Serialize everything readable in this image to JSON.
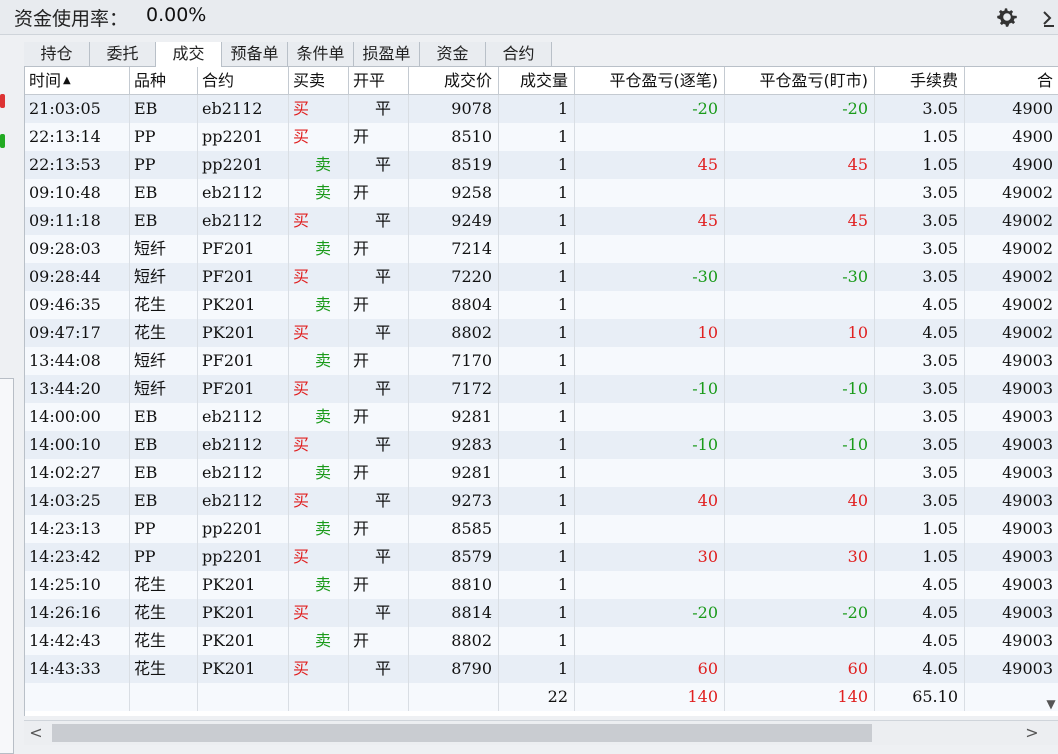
{
  "header": {
    "usage_label": "资金使用率：",
    "usage_value": "0.00%",
    "settings_icon": "gear-icon",
    "corner_icon": "chevron-icon"
  },
  "tabs": [
    {
      "label": "持仓"
    },
    {
      "label": "委托"
    },
    {
      "label": "成交",
      "active": true
    },
    {
      "label": "预备单"
    },
    {
      "label": "条件单"
    },
    {
      "label": "损盈单"
    },
    {
      "label": "资金"
    },
    {
      "label": "合约"
    }
  ],
  "table": {
    "columns": [
      "时间",
      "品种",
      "合约",
      "买卖",
      "开平",
      "成交价",
      "成交量",
      "平仓盈亏(逐笔)",
      "平仓盈亏(盯市)",
      "手续费",
      "合"
    ],
    "rows": [
      [
        "21:03:05",
        "EB",
        "eb2112",
        "买",
        "平",
        "9078",
        "1",
        "-20",
        "-20",
        "3.05",
        "4900"
      ],
      [
        "22:13:14",
        "PP",
        "pp2201",
        "买",
        "开",
        "8510",
        "1",
        "",
        "",
        "1.05",
        "4900"
      ],
      [
        "22:13:53",
        "PP",
        "pp2201",
        "卖",
        "平",
        "8519",
        "1",
        "45",
        "45",
        "1.05",
        "4900"
      ],
      [
        "09:10:48",
        "EB",
        "eb2112",
        "卖",
        "开",
        "9258",
        "1",
        "",
        "",
        "3.05",
        "49002"
      ],
      [
        "09:11:18",
        "EB",
        "eb2112",
        "买",
        "平",
        "9249",
        "1",
        "45",
        "45",
        "3.05",
        "49002"
      ],
      [
        "09:28:03",
        "短纤",
        "PF201",
        "卖",
        "开",
        "7214",
        "1",
        "",
        "",
        "3.05",
        "49002"
      ],
      [
        "09:28:44",
        "短纤",
        "PF201",
        "买",
        "平",
        "7220",
        "1",
        "-30",
        "-30",
        "3.05",
        "49002"
      ],
      [
        "09:46:35",
        "花生",
        "PK201",
        "卖",
        "开",
        "8804",
        "1",
        "",
        "",
        "4.05",
        "49002"
      ],
      [
        "09:47:17",
        "花生",
        "PK201",
        "买",
        "平",
        "8802",
        "1",
        "10",
        "10",
        "4.05",
        "49002"
      ],
      [
        "13:44:08",
        "短纤",
        "PF201",
        "卖",
        "开",
        "7170",
        "1",
        "",
        "",
        "3.05",
        "49003"
      ],
      [
        "13:44:20",
        "短纤",
        "PF201",
        "买",
        "平",
        "7172",
        "1",
        "-10",
        "-10",
        "3.05",
        "49003"
      ],
      [
        "14:00:00",
        "EB",
        "eb2112",
        "卖",
        "开",
        "9281",
        "1",
        "",
        "",
        "3.05",
        "49003"
      ],
      [
        "14:00:10",
        "EB",
        "eb2112",
        "买",
        "平",
        "9283",
        "1",
        "-10",
        "-10",
        "3.05",
        "49003"
      ],
      [
        "14:02:27",
        "EB",
        "eb2112",
        "卖",
        "开",
        "9281",
        "1",
        "",
        "",
        "3.05",
        "49003"
      ],
      [
        "14:03:25",
        "EB",
        "eb2112",
        "买",
        "平",
        "9273",
        "1",
        "40",
        "40",
        "3.05",
        "49003"
      ],
      [
        "14:23:13",
        "PP",
        "pp2201",
        "卖",
        "开",
        "8585",
        "1",
        "",
        "",
        "1.05",
        "49003"
      ],
      [
        "14:23:42",
        "PP",
        "pp2201",
        "买",
        "平",
        "8579",
        "1",
        "30",
        "30",
        "1.05",
        "49003"
      ],
      [
        "14:25:10",
        "花生",
        "PK201",
        "卖",
        "开",
        "8810",
        "1",
        "",
        "",
        "4.05",
        "49003"
      ],
      [
        "14:26:16",
        "花生",
        "PK201",
        "买",
        "平",
        "8814",
        "1",
        "-20",
        "-20",
        "4.05",
        "49003"
      ],
      [
        "14:42:43",
        "花生",
        "PK201",
        "卖",
        "开",
        "8802",
        "1",
        "",
        "",
        "4.05",
        "49003"
      ],
      [
        "14:43:33",
        "花生",
        "PK201",
        "买",
        "平",
        "8790",
        "1",
        "60",
        "60",
        "4.05",
        "49003"
      ]
    ],
    "totals": {
      "volume": "22",
      "pnl_trade": "140",
      "pnl_mark": "140",
      "fee": "65.10"
    },
    "colors": {
      "buy": "#e02020",
      "sell": "#1a9a1a",
      "profit": "#e02020",
      "loss": "#1a9a1a"
    }
  },
  "scrollbar": {
    "left_arrow": "<",
    "right_arrow": ">"
  }
}
